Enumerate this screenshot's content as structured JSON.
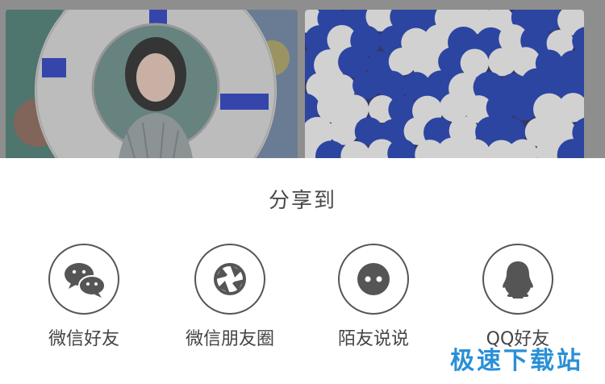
{
  "share_sheet": {
    "title": "分享到",
    "options": [
      {
        "label": "微信好友",
        "icon": "wechat-icon"
      },
      {
        "label": "微信朋友圈",
        "icon": "moments-shutter-icon"
      },
      {
        "label": "陌友说说",
        "icon": "momo-face-icon"
      },
      {
        "label": "QQ好友",
        "icon": "qq-penguin-icon"
      }
    ]
  },
  "watermark": "极速下载站",
  "colors": {
    "dim_overlay": "#8e8e8e",
    "icon_stroke": "#555555",
    "label_text": "#444444",
    "watermark": "#2a8fd6",
    "ball_blue": "#1f3fb5",
    "ball_white": "#f2f2f2"
  }
}
